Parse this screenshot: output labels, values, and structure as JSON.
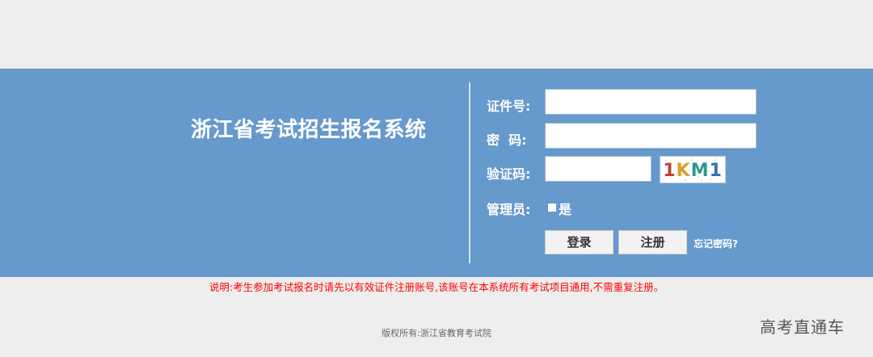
{
  "header": {
    "system_title": "浙江省考试招生报名系统"
  },
  "login_form": {
    "id_label": "证件号:",
    "id_value": "",
    "password_label": "密  码:",
    "password_value": "",
    "captcha_label": "验证码:",
    "captcha_value": "",
    "captcha_text": "1KM1",
    "admin_label": "管理员:",
    "admin_option": "是",
    "admin_checked": false,
    "login_button": "登录",
    "register_button": "注册",
    "forgot_link": "忘记密码?"
  },
  "notice": "说明:考生参加考试报名时请先以有效证件注册账号,该账号在本系统所有考试项目通用,不需重复注册。",
  "footer": {
    "copyright": "版权所有:浙江省教育考试院"
  },
  "watermark": "高考直通车",
  "colors": {
    "band_background": "#6699cc",
    "page_background": "#eeeeee",
    "notice_text": "#ff0000",
    "button_background": "#f2f2f2"
  }
}
